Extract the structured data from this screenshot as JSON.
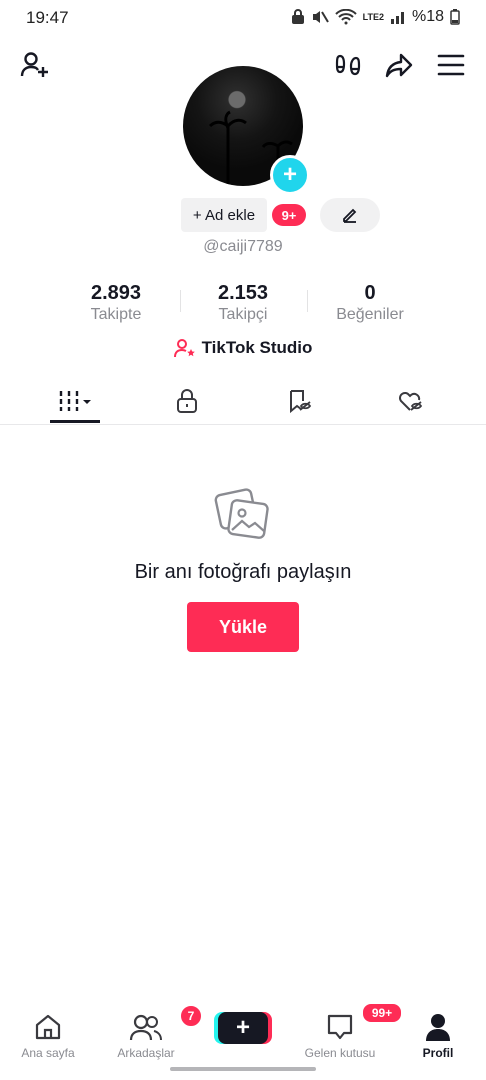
{
  "status_bar": {
    "time": "19:47",
    "battery_text": "%18",
    "network_text": "LTE2"
  },
  "profile": {
    "add_name_label": "+ Ad ekle",
    "notification_badge": "9+",
    "username": "@caiji7789",
    "stats": [
      {
        "value": "2.893",
        "label": "Takipte"
      },
      {
        "value": "2.153",
        "label": "Takipçi"
      },
      {
        "value": "0",
        "label": "Beğeniler"
      }
    ],
    "studio_label": "TikTok Studio"
  },
  "empty_state": {
    "title": "Bir anı fotoğrafı paylaşın",
    "button_label": "Yükle"
  },
  "bottom_nav": {
    "items": [
      {
        "label": "Ana sayfa",
        "icon": "home-icon"
      },
      {
        "label": "Arkadaşlar",
        "icon": "friends-icon",
        "badge": "7"
      },
      {
        "label": "",
        "icon": "create-icon"
      },
      {
        "label": "Gelen kutusu",
        "icon": "inbox-icon",
        "badge": "99+"
      },
      {
        "label": "Profil",
        "icon": "profile-icon"
      }
    ],
    "active": "Profil"
  },
  "colors": {
    "accent": "#fe2c55",
    "cyan": "#20d5ec",
    "text_primary": "#161823",
    "text_secondary": "#8a8b91"
  }
}
